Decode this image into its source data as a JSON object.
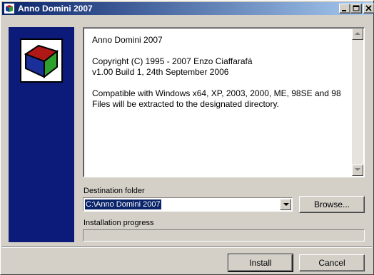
{
  "window": {
    "title": "Anno Domini 2007",
    "controls": [
      "minimize-icon",
      "maximize-icon",
      "close-icon"
    ]
  },
  "info": {
    "lines": [
      "Anno Domini 2007",
      "",
      "Copyright (C) 1995 - 2007 Enzo Ciaffarafá",
      "v1.00 Build 1, 24th September 2006",
      "",
      "Compatible with Windows x64, XP, 2003, 2000, ME, 98SE and 98",
      "Files will be extracted to the designated directory."
    ]
  },
  "destination": {
    "label": "Destination folder",
    "value": "C:\\Anno Domini 2007",
    "browse_label": "Browse..."
  },
  "progress": {
    "label": "Installation progress",
    "value": 0
  },
  "buttons": {
    "install_label": "Install",
    "cancel_label": "Cancel"
  },
  "colors": {
    "title_gradient_start": "#0a246a",
    "title_gradient_end": "#a6caf0",
    "side_panel": "#0c1b7a",
    "window_face": "#d4d0c8",
    "selection": "#0a246a"
  }
}
